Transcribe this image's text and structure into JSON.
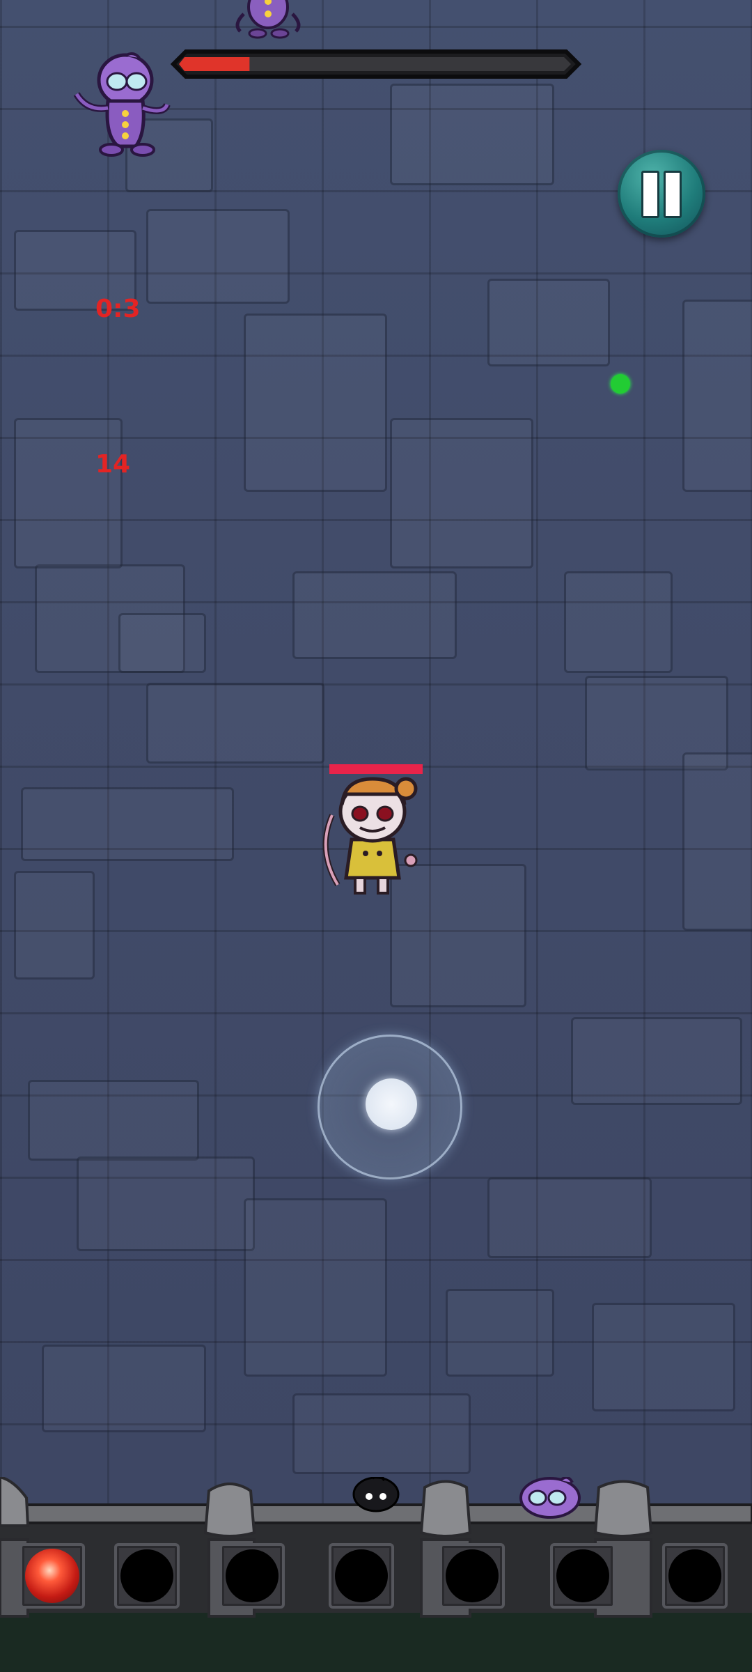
{
  "hud": {
    "boss_hp_percent": 18,
    "timer_text": "0:3",
    "counter_text": "14",
    "pause_icon": "pause-icon"
  },
  "hero": {
    "hp_percent": 100
  },
  "skills": [
    {
      "state": "active",
      "icon": "fire-slash-icon"
    },
    {
      "state": "empty"
    },
    {
      "state": "empty"
    },
    {
      "state": "empty"
    },
    {
      "state": "empty"
    },
    {
      "state": "empty"
    },
    {
      "state": "empty"
    }
  ],
  "colors": {
    "hp_fill": "#e0342a",
    "debug_text": "#e32424",
    "pause_button": "#1f7c7a",
    "hero_hp": "#e8244a",
    "pickup_dot": "#22cc33"
  }
}
